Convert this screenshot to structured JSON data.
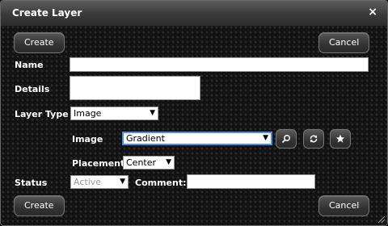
{
  "dialog": {
    "title": "Create Layer",
    "close_icon": "×"
  },
  "toolbar": {
    "create_label": "Create",
    "cancel_label": "Cancel"
  },
  "form": {
    "name_label": "Name",
    "name_value": "",
    "details_label": "Details",
    "details_value": "",
    "layer_type_label": "Layer Type",
    "layer_type_value": "Image",
    "image_label": "Image",
    "image_value": "Gradient",
    "placement_label": "Placement",
    "placement_value": "Center",
    "status_label": "Status",
    "status_value": "Active",
    "comment_label": "Comment:",
    "comment_value": ""
  },
  "icons": {
    "search": "search-icon",
    "refresh": "refresh-icon",
    "star": "star-icon"
  },
  "footer": {
    "create_label": "Create",
    "cancel_label": "Cancel"
  }
}
